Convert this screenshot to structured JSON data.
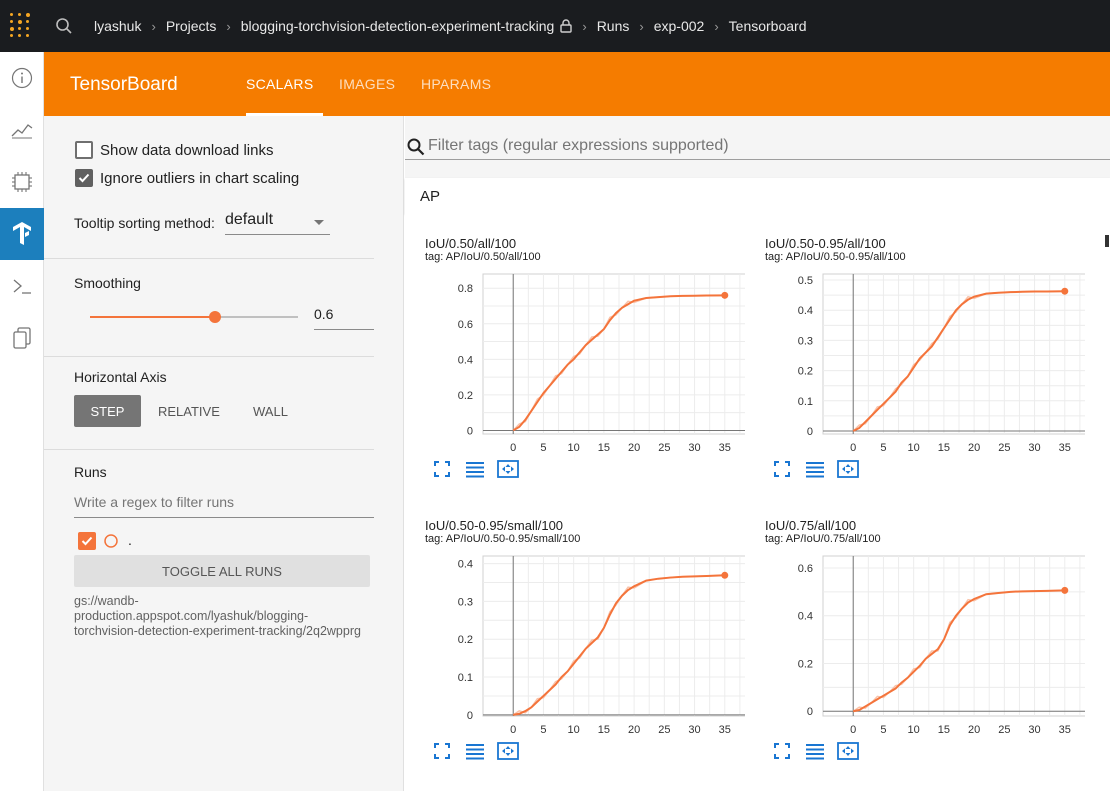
{
  "breadcrumbs": [
    "lyashuk",
    "Projects",
    "blogging-torchvision-detection-experiment-tracking",
    "Runs",
    "exp-002",
    "Tensorboard"
  ],
  "header": {
    "title": "TensorBoard",
    "tabs": [
      {
        "label": "SCALARS",
        "active": true
      },
      {
        "label": "IMAGES",
        "active": false
      },
      {
        "label": "HPARAMS",
        "active": false
      }
    ]
  },
  "sidebar": {
    "show_download_label": "Show data download links",
    "show_download_checked": false,
    "ignore_outliers_label": "Ignore outliers in chart scaling",
    "ignore_outliers_checked": true,
    "tooltip_label": "Tooltip sorting method:",
    "tooltip_value": "default",
    "smoothing_label": "Smoothing",
    "smoothing_value": "0.6",
    "smoothing_fraction": 0.6,
    "horizontal_axis_label": "Horizontal Axis",
    "axis_options": [
      "STEP",
      "RELATIVE",
      "WALL"
    ],
    "axis_selected": "STEP",
    "runs_label": "Runs",
    "runs_filter_placeholder": "Write a regex to filter runs",
    "run_name": ".",
    "toggle_all_label": "TOGGLE ALL RUNS",
    "run_path": "gs://wandb-production.appspot.com/lyashuk/blogging-torchvision-detection-experiment-tracking/2q2wpprg"
  },
  "main": {
    "filter_placeholder": "Filter tags (regular expressions supported)",
    "group_name": "AP"
  },
  "colors": {
    "accent": "#f57c00",
    "series": "#f4743b",
    "series_raw": "#f9c2a9"
  },
  "chart_data": [
    {
      "type": "line",
      "title": "IoU/0.50/all/100",
      "subtitle": "tag: AP/IoU/0.50/all/100",
      "x": [
        0,
        1,
        2,
        3,
        4,
        5,
        6,
        7,
        8,
        9,
        10,
        11,
        12,
        13,
        14,
        15,
        16,
        17,
        18,
        19,
        20,
        22,
        24,
        26,
        28,
        30,
        32,
        35
      ],
      "y": [
        0,
        0.02,
        0.06,
        0.11,
        0.16,
        0.21,
        0.25,
        0.29,
        0.33,
        0.37,
        0.4,
        0.44,
        0.48,
        0.51,
        0.54,
        0.57,
        0.62,
        0.66,
        0.69,
        0.71,
        0.73,
        0.745,
        0.75,
        0.755,
        0.757,
        0.758,
        0.759,
        0.76
      ],
      "xticks": [
        0,
        5,
        10,
        15,
        20,
        25,
        30,
        35
      ],
      "yticks": [
        0,
        0.2,
        0.4,
        0.6,
        0.8
      ],
      "xlim": [
        -5,
        40
      ],
      "ylim": [
        -0.02,
        0.88
      ]
    },
    {
      "type": "line",
      "title": "IoU/0.50-0.95/all/100",
      "subtitle": "tag: AP/IoU/0.50-0.95/all/100",
      "x": [
        0,
        1,
        2,
        3,
        4,
        5,
        6,
        7,
        8,
        9,
        10,
        11,
        12,
        13,
        14,
        15,
        16,
        17,
        18,
        19,
        20,
        22,
        24,
        26,
        28,
        30,
        32,
        35
      ],
      "y": [
        0,
        0.01,
        0.03,
        0.05,
        0.07,
        0.09,
        0.11,
        0.13,
        0.16,
        0.18,
        0.21,
        0.24,
        0.26,
        0.28,
        0.31,
        0.34,
        0.37,
        0.4,
        0.42,
        0.435,
        0.445,
        0.455,
        0.458,
        0.46,
        0.461,
        0.462,
        0.462,
        0.463
      ],
      "xticks": [
        0,
        5,
        10,
        15,
        20,
        25,
        30,
        35
      ],
      "yticks": [
        0,
        0.1,
        0.2,
        0.3,
        0.4,
        0.5
      ],
      "xlim": [
        -5,
        40
      ],
      "ylim": [
        -0.01,
        0.52
      ]
    },
    {
      "type": "line",
      "title": "IoU/0.50-0.95/small/100",
      "subtitle": "tag: AP/IoU/0.50-0.95/small/100",
      "x": [
        0,
        1,
        2,
        3,
        4,
        5,
        6,
        7,
        8,
        9,
        10,
        11,
        12,
        13,
        14,
        15,
        16,
        17,
        18,
        19,
        20,
        22,
        24,
        26,
        28,
        30,
        32,
        35
      ],
      "y": [
        0,
        0.003,
        0.01,
        0.02,
        0.035,
        0.05,
        0.065,
        0.08,
        0.1,
        0.115,
        0.135,
        0.155,
        0.175,
        0.19,
        0.205,
        0.23,
        0.265,
        0.295,
        0.315,
        0.33,
        0.34,
        0.355,
        0.36,
        0.363,
        0.365,
        0.366,
        0.367,
        0.369
      ],
      "xticks": [
        0,
        5,
        10,
        15,
        20,
        25,
        30,
        35
      ],
      "yticks": [
        0,
        0.1,
        0.2,
        0.3,
        0.4
      ],
      "xlim": [
        -5,
        40
      ],
      "ylim": [
        -0.003,
        0.42
      ]
    },
    {
      "type": "line",
      "title": "IoU/0.75/all/100",
      "subtitle": "tag: AP/IoU/0.75/all/100",
      "x": [
        0,
        1,
        2,
        3,
        4,
        5,
        6,
        7,
        8,
        9,
        10,
        11,
        12,
        13,
        14,
        15,
        16,
        17,
        18,
        19,
        20,
        22,
        24,
        26,
        28,
        30,
        32,
        35
      ],
      "y": [
        0,
        0.005,
        0.02,
        0.035,
        0.05,
        0.065,
        0.08,
        0.095,
        0.12,
        0.14,
        0.165,
        0.19,
        0.22,
        0.24,
        0.26,
        0.3,
        0.36,
        0.4,
        0.43,
        0.455,
        0.47,
        0.49,
        0.495,
        0.5,
        0.502,
        0.503,
        0.504,
        0.506
      ],
      "xticks": [
        0,
        5,
        10,
        15,
        20,
        25,
        30,
        35
      ],
      "yticks": [
        0,
        0.2,
        0.4,
        0.6
      ],
      "xlim": [
        -5,
        40
      ],
      "ylim": [
        -0.02,
        0.65
      ]
    }
  ]
}
